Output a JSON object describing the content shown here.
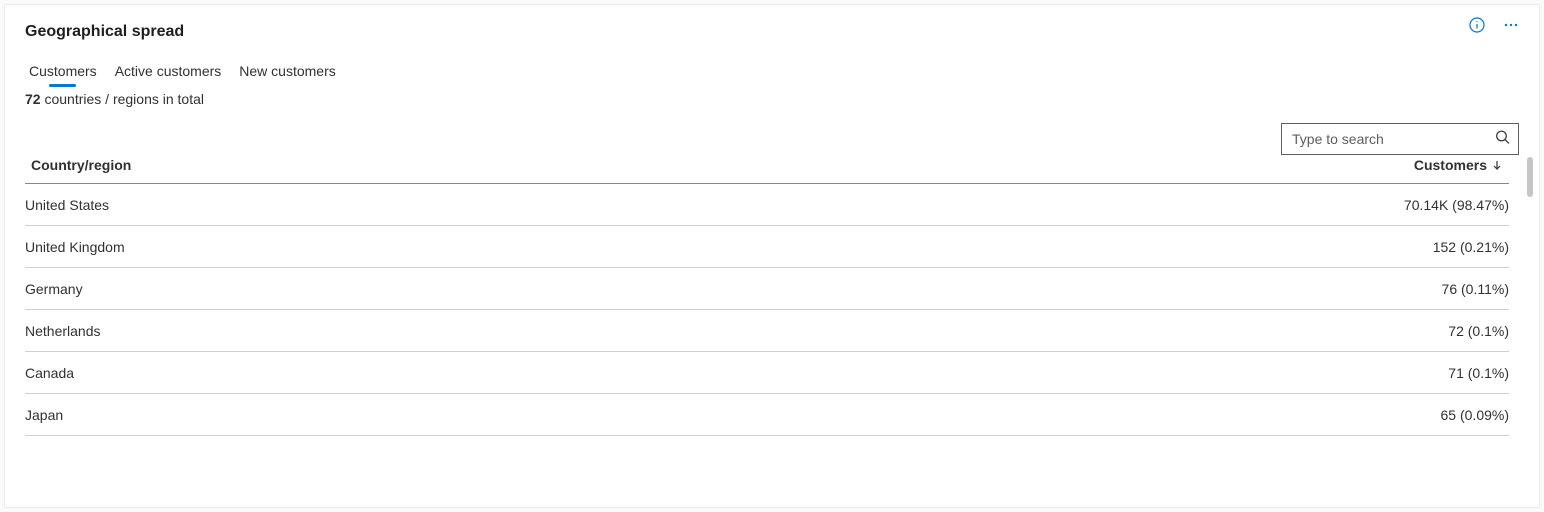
{
  "header": {
    "title": "Geographical spread"
  },
  "tabs": [
    {
      "label": "Customers",
      "active": true
    },
    {
      "label": "Active customers",
      "active": false
    },
    {
      "label": "New customers",
      "active": false
    }
  ],
  "summary": {
    "count": "72",
    "suffix": " countries / regions in total"
  },
  "search": {
    "placeholder": "Type to search",
    "value": ""
  },
  "table": {
    "columns": {
      "left": "Country/region",
      "right": "Customers"
    },
    "sort_direction": "desc",
    "rows": [
      {
        "country": "United States",
        "value": "70.14K (98.47%)"
      },
      {
        "country": "United Kingdom",
        "value": "152 (0.21%)"
      },
      {
        "country": "Germany",
        "value": "76 (0.11%)"
      },
      {
        "country": "Netherlands",
        "value": "72 (0.1%)"
      },
      {
        "country": "Canada",
        "value": "71 (0.1%)"
      },
      {
        "country": "Japan",
        "value": "65 (0.09%)"
      }
    ]
  }
}
